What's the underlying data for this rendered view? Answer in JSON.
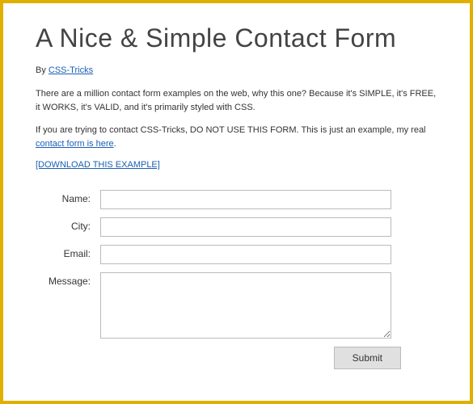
{
  "title": "A Nice & Simple Contact Form",
  "byline_prefix": "By ",
  "author": "CSS-Tricks",
  "paragraph1": "There are a million contact form examples on the web, why this one? Because it's SIMPLE, it's FREE, it WORKS, it's VALID, and it's primarily styled with CSS.",
  "paragraph2_prefix": "If you are trying to contact CSS-Tricks, DO NOT USE THIS FORM. This is just an example, my real ",
  "paragraph2_link": "contact form is here",
  "paragraph2_suffix": ".",
  "download_link": "[DOWNLOAD THIS EXAMPLE]",
  "form": {
    "name_label": "Name:",
    "city_label": "City:",
    "email_label": "Email:",
    "message_label": "Message:",
    "submit_label": "Submit"
  }
}
